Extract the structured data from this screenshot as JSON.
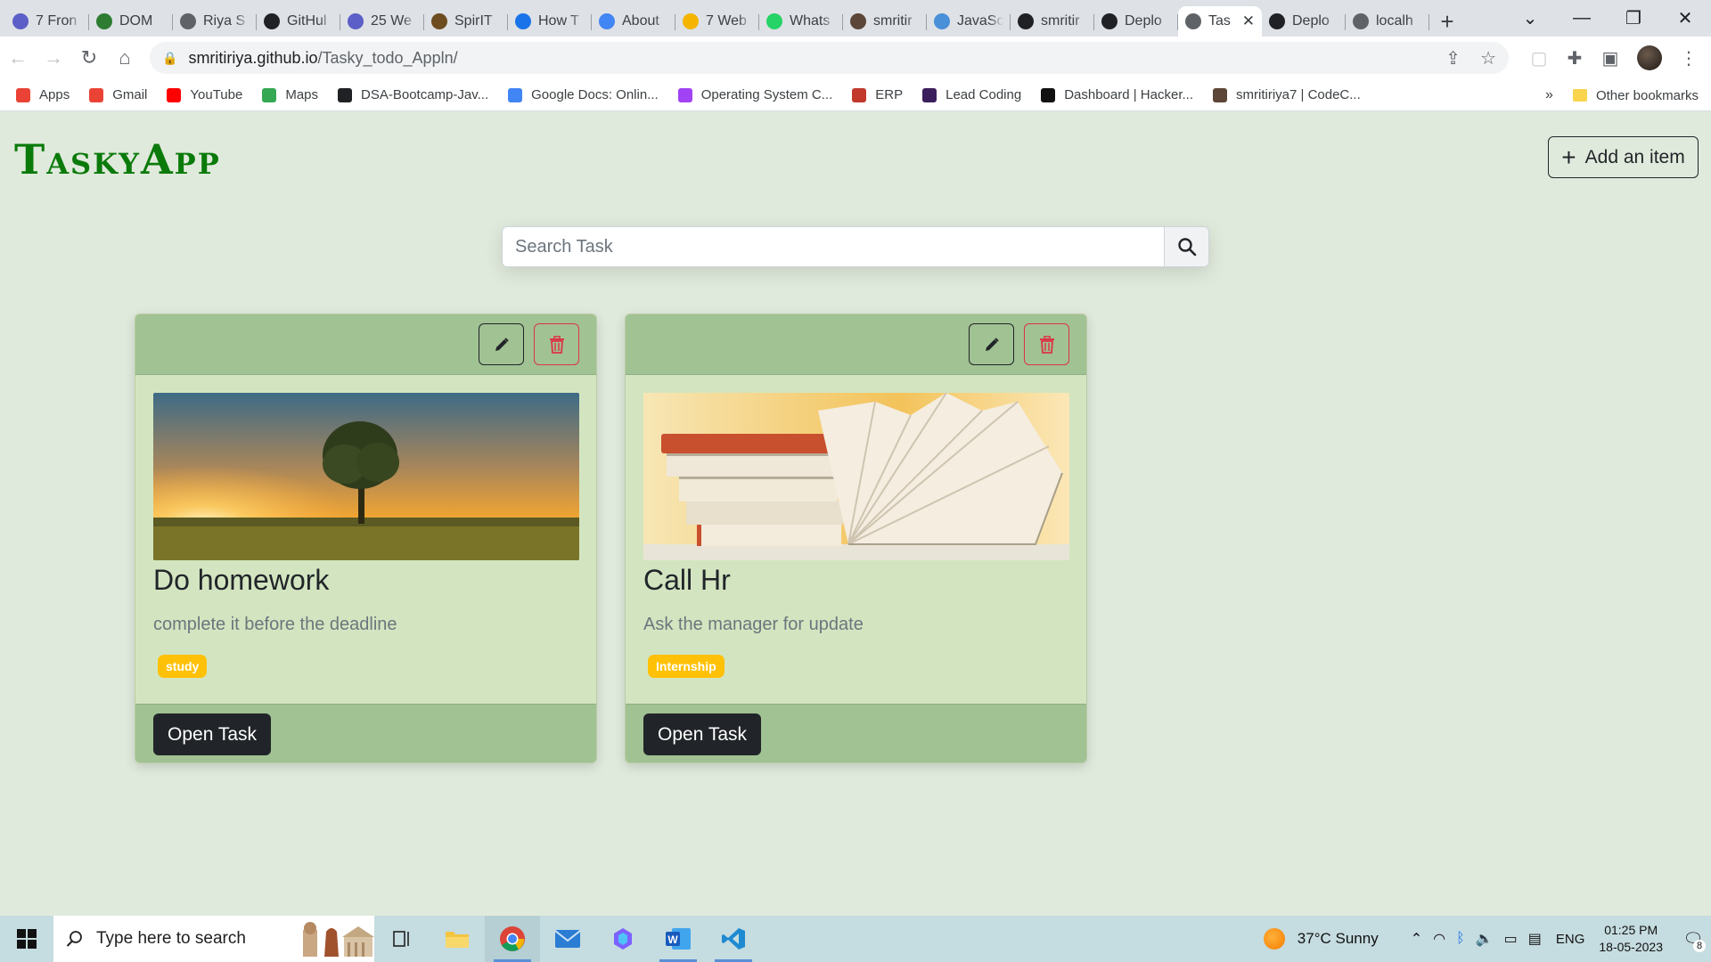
{
  "browser": {
    "tabs": [
      {
        "title": "7 Fron",
        "icon": "mail-icon",
        "color": "#5b5fc7"
      },
      {
        "title": "DOM",
        "icon": "link-icon",
        "color": "#2e7d32"
      },
      {
        "title": "Riya S",
        "icon": "globe-icon",
        "color": "#5f6368"
      },
      {
        "title": "GitHul",
        "icon": "github-icon",
        "color": "#202124"
      },
      {
        "title": "25 We",
        "icon": "bookmark-icon",
        "color": "#5b5fc7"
      },
      {
        "title": "SpirIT",
        "icon": "book-icon",
        "color": "#6d4c1f"
      },
      {
        "title": "How T",
        "icon": "info-icon",
        "color": "#1a73e8"
      },
      {
        "title": "About",
        "icon": "google-icon",
        "color": "#4285f4"
      },
      {
        "title": "7 Web",
        "icon": "web-icon",
        "color": "#f4b400"
      },
      {
        "title": "Whats",
        "icon": "whatsapp-icon",
        "color": "#25d366"
      },
      {
        "title": "smritir",
        "icon": "codechef-icon",
        "color": "#5b4638"
      },
      {
        "title": "JavaSc",
        "icon": "chart-icon",
        "color": "#4a90d9"
      },
      {
        "title": "smritir",
        "icon": "github-icon",
        "color": "#202124"
      },
      {
        "title": "Deplo",
        "icon": "github-icon",
        "color": "#202124"
      },
      {
        "title": "Tas",
        "icon": "globe-icon",
        "color": "#5f6368",
        "active": true
      },
      {
        "title": "Deplo",
        "icon": "github-icon",
        "color": "#202124"
      },
      {
        "title": "localh",
        "icon": "globe-icon",
        "color": "#5f6368"
      }
    ],
    "url_host": "smritiriya.github.io",
    "url_path": "/Tasky_todo_Appln/",
    "bookmarks": [
      {
        "label": "Apps",
        "icon": "apps-icon",
        "color": "#ea4335"
      },
      {
        "label": "Gmail",
        "icon": "gmail-icon",
        "color": "#ea4335"
      },
      {
        "label": "YouTube",
        "icon": "youtube-icon",
        "color": "#ff0000"
      },
      {
        "label": "Maps",
        "icon": "maps-icon",
        "color": "#34a853"
      },
      {
        "label": "DSA-Bootcamp-Jav...",
        "icon": "github-icon",
        "color": "#202124"
      },
      {
        "label": "Google Docs: Onlin...",
        "icon": "docs-icon",
        "color": "#4285f4"
      },
      {
        "label": "Operating System C...",
        "icon": "os-icon",
        "color": "#a142f4"
      },
      {
        "label": "ERP",
        "icon": "erp-icon",
        "color": "#c0392b"
      },
      {
        "label": "Lead Coding",
        "icon": "leadcoding-icon",
        "color": "#3b1f5c"
      },
      {
        "label": "Dashboard | Hacker...",
        "icon": "hackerrank-icon",
        "color": "#111111"
      },
      {
        "label": "smritiriya7 | CodeC...",
        "icon": "codechef-icon",
        "color": "#5b4638"
      }
    ],
    "other_bookmarks": "Other bookmarks"
  },
  "app": {
    "brand": "TaskyApp",
    "add_button": "Add an item",
    "search_placeholder": "Search Task",
    "tasks": [
      {
        "title": "Do homework",
        "description": "complete it before the deadline",
        "tag": "study",
        "open_label": "Open Task",
        "image": "tree-sunset"
      },
      {
        "title": "Call Hr",
        "description": "Ask the manager for update",
        "tag": "Internship",
        "open_label": "Open Task",
        "image": "books"
      }
    ],
    "colors": {
      "brand": "#0a7a0a",
      "card_bg": "#d3e5c0",
      "card_header": "#a1c293",
      "badge": "#ffc107",
      "danger": "#dc3545"
    }
  },
  "taskbar": {
    "search_text": "Type here to search",
    "weather": "37°C  Sunny",
    "language": "ENG",
    "time": "01:25 PM",
    "date": "18-05-2023",
    "notification_count": "8"
  }
}
